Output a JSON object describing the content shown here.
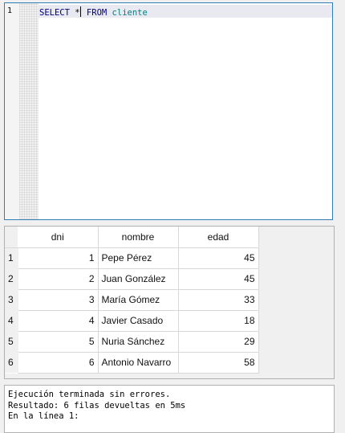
{
  "editor": {
    "line_number": "1",
    "kw_select": "SELECT",
    "star": "*",
    "kw_from": "FROM",
    "table": "cliente"
  },
  "results": {
    "columns": [
      "dni",
      "nombre",
      "edad"
    ],
    "rows": [
      {
        "n": "1",
        "dni": "1",
        "nombre": "Pepe Pérez",
        "edad": "45"
      },
      {
        "n": "2",
        "dni": "2",
        "nombre": "Juan González",
        "edad": "45"
      },
      {
        "n": "3",
        "dni": "3",
        "nombre": "María Gómez",
        "edad": "33"
      },
      {
        "n": "4",
        "dni": "4",
        "nombre": "Javier Casado",
        "edad": "18"
      },
      {
        "n": "5",
        "dni": "5",
        "nombre": "Nuria Sánchez",
        "edad": "29"
      },
      {
        "n": "6",
        "dni": "6",
        "nombre": "Antonio Navarro",
        "edad": "58"
      }
    ]
  },
  "message": {
    "line1": "Ejecución terminada sin errores.",
    "line2": "Resultado: 6 filas devueltas en 5ms",
    "line3": "En la línea 1:"
  }
}
